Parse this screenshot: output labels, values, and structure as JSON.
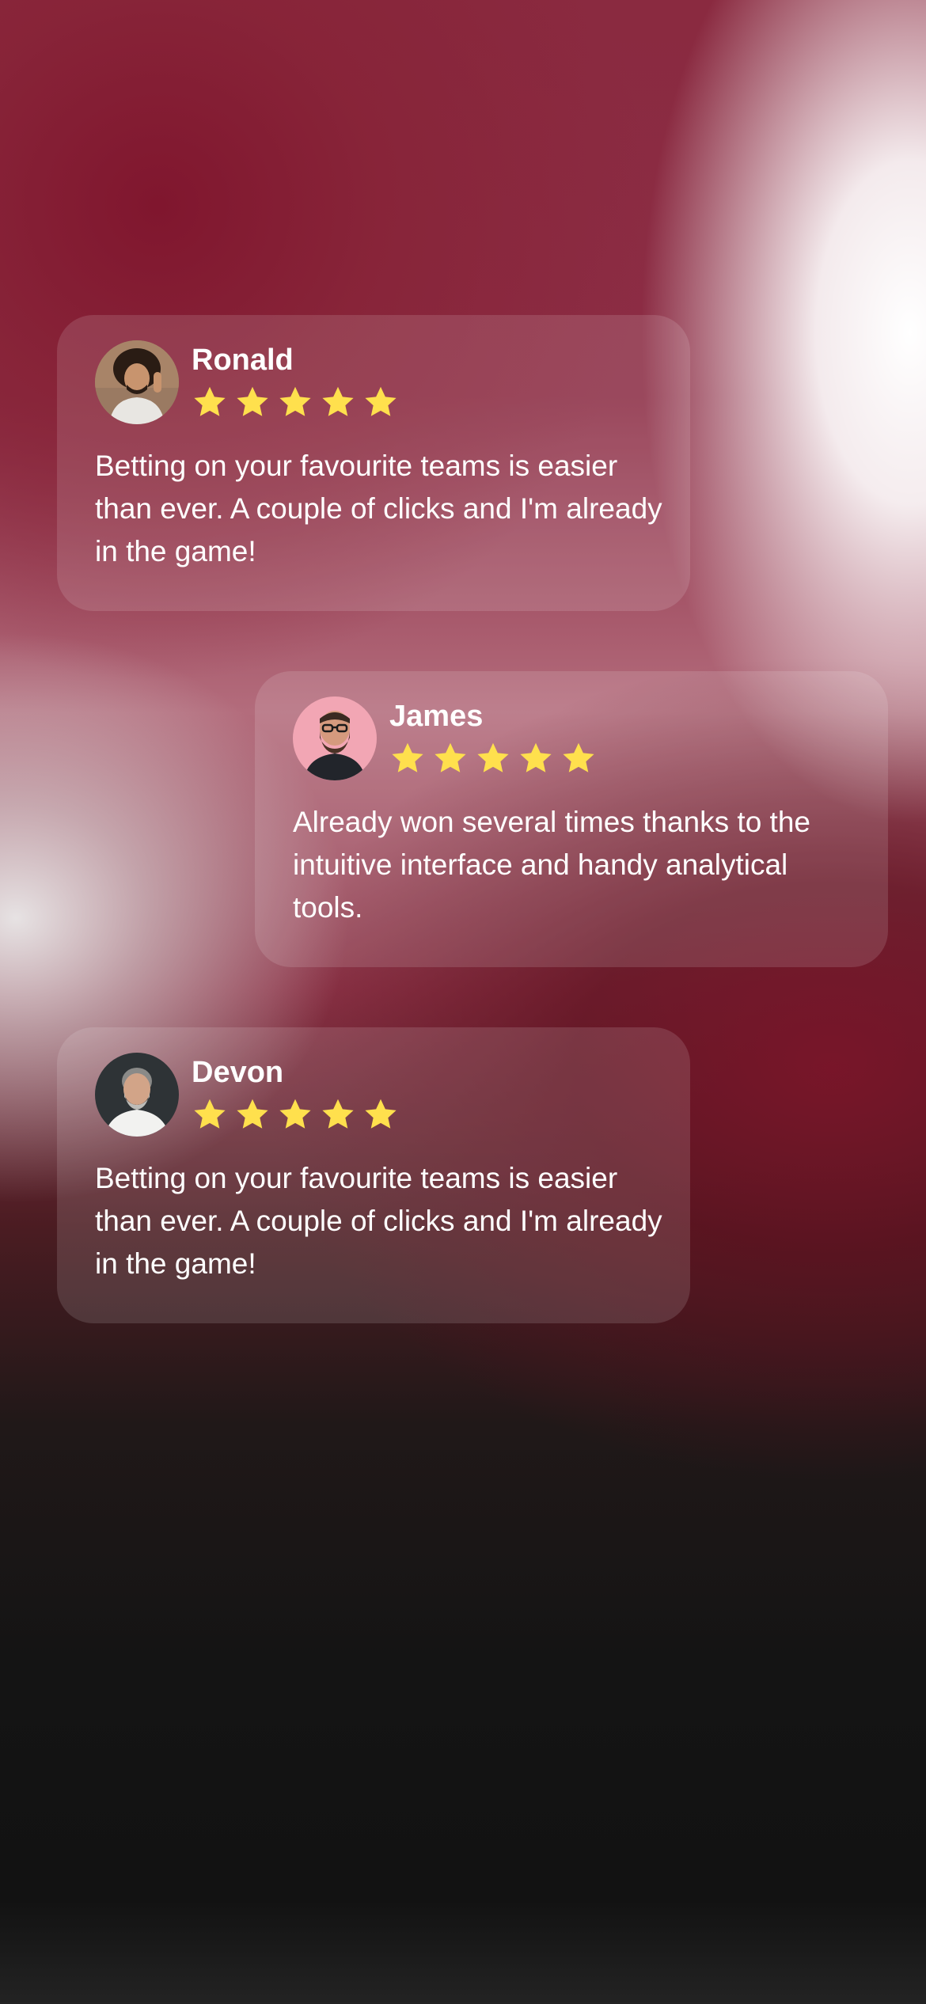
{
  "reviews": [
    {
      "name": "Ronald",
      "rating": 5,
      "text": "Betting on your favourite teams is easier than ever. A couple of clicks and I'm already in the game!",
      "avatar_icon": "avatar-photo-curly-hair-man"
    },
    {
      "name": "James",
      "rating": 5,
      "text": "Already won several times thanks to the intuitive interface and handy analytical tools.",
      "avatar_icon": "avatar-photo-bearded-man-glasses"
    },
    {
      "name": "Devon",
      "rating": 5,
      "text": "Betting on your favourite teams is easier than ever. A couple of clicks and I'm already in the game!",
      "avatar_icon": "avatar-photo-grey-beard-man"
    }
  ],
  "colors": {
    "star": "#FFE04D",
    "card_background": "rgba(255,255,255,0.13)",
    "text": "#FFFFFF",
    "accent_red": "#8A1E36"
  }
}
